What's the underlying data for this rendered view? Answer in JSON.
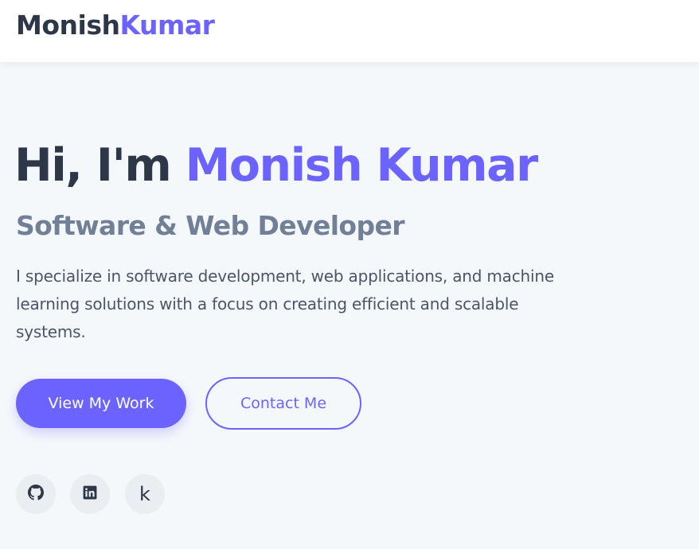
{
  "header": {
    "logo_first": "Monish",
    "logo_accent": "Kumar"
  },
  "hero": {
    "greeting": "Hi, I'm ",
    "name": "Monish Kumar",
    "subtitle": "Software & Web Developer",
    "description": "I specialize in software development, web applications, and machine learning solutions with a focus on creating efficient and scalable systems.",
    "primary_button": "View My Work",
    "secondary_button": "Contact Me"
  },
  "social": {
    "items": [
      {
        "icon": "github-icon"
      },
      {
        "icon": "linkedin-icon"
      },
      {
        "icon": "kaggle-icon",
        "glyph": "k"
      }
    ]
  },
  "colors": {
    "accent": "#6c63ff",
    "heading": "#2d3748",
    "subtitle": "#718096",
    "body_text": "#4a5568",
    "background": "#f5f8fb",
    "header_bg": "#ffffff"
  }
}
